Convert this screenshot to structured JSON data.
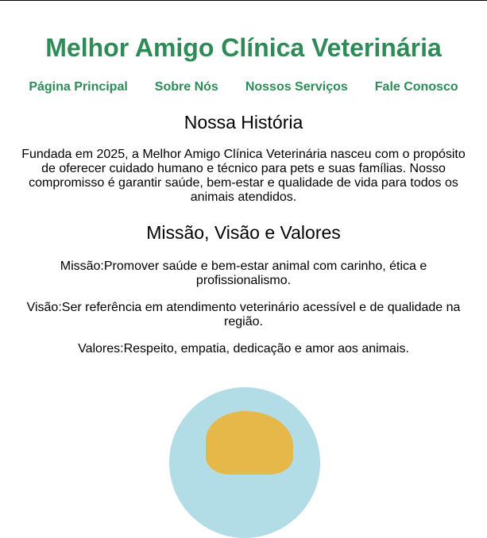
{
  "header": {
    "title": "Melhor Amigo Clínica Veterinária"
  },
  "nav": {
    "items": [
      {
        "label": "Página Principal"
      },
      {
        "label": "Sobre Nós"
      },
      {
        "label": "Nossos Serviços"
      },
      {
        "label": "Fale Conosco"
      }
    ]
  },
  "history": {
    "heading": "Nossa História",
    "text": "Fundada em 2025, a Melhor Amigo Clínica Veterinária nasceu com o propósito de oferecer cuidado humano e técnico para pets e suas famílias. Nosso compromisso é garantir saúde, bem-estar e qualidade de vida para todos os animais atendidos."
  },
  "mvv": {
    "heading": "Missão, Visão e Valores",
    "mission": "Missão:Promover saúde e bem-estar animal com carinho, ética e profissionalismo.",
    "vision": "Visão:Ser referência em atendimento veterinário acessível e de qualidade na região.",
    "values": "Valores:Respeito, empatia, dedicação e amor aos animais."
  },
  "colors": {
    "brand_green": "#2e8b57",
    "image_circle": "#b3dde6"
  }
}
